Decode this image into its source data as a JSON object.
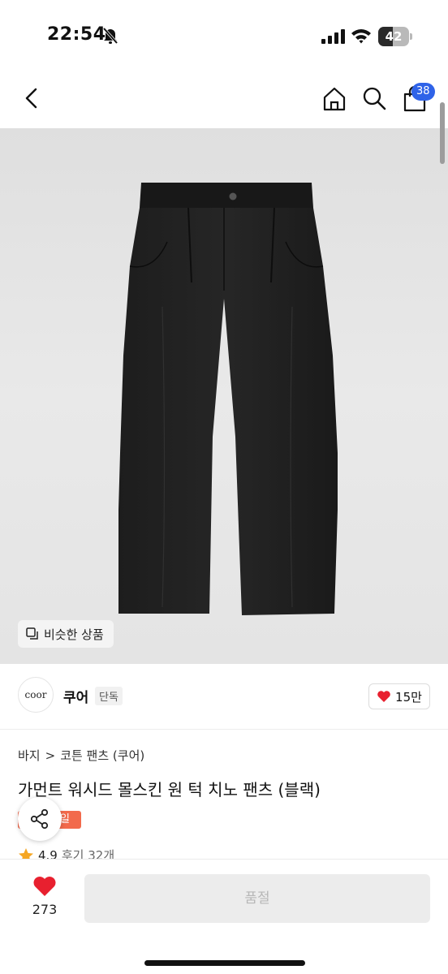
{
  "status_bar": {
    "time": "22:54",
    "battery": "42"
  },
  "header": {
    "cart_count": "38"
  },
  "image": {
    "similar_label": "비슷한 상품"
  },
  "brand": {
    "logo_text": "coor",
    "name": "쿠어",
    "tag": "단독",
    "likes": "15만"
  },
  "breadcrumb": {
    "category": "바지",
    "separator": ">",
    "subcategory": "코튼 팬츠 (쿠어)"
  },
  "product": {
    "title": "가먼트 워시드 몰스킨 원 턱 치노 팬츠 (블랙)",
    "badge": "일",
    "rating": "4.9",
    "reviews": "후기 32개"
  },
  "bottom_bar": {
    "wish_count": "273",
    "purchase_label": "품절"
  },
  "colors": {
    "accent_blue": "#2f63e8",
    "heart_red": "#e8202f",
    "sale_orange": "#f26a4c",
    "star_orange": "#f5a623"
  },
  "icons": [
    "bell-slash-icon",
    "signal-icon",
    "wifi-icon",
    "back-icon",
    "home-icon",
    "search-icon",
    "cart-icon",
    "similar-icon",
    "heart-icon",
    "share-icon",
    "star-icon"
  ]
}
